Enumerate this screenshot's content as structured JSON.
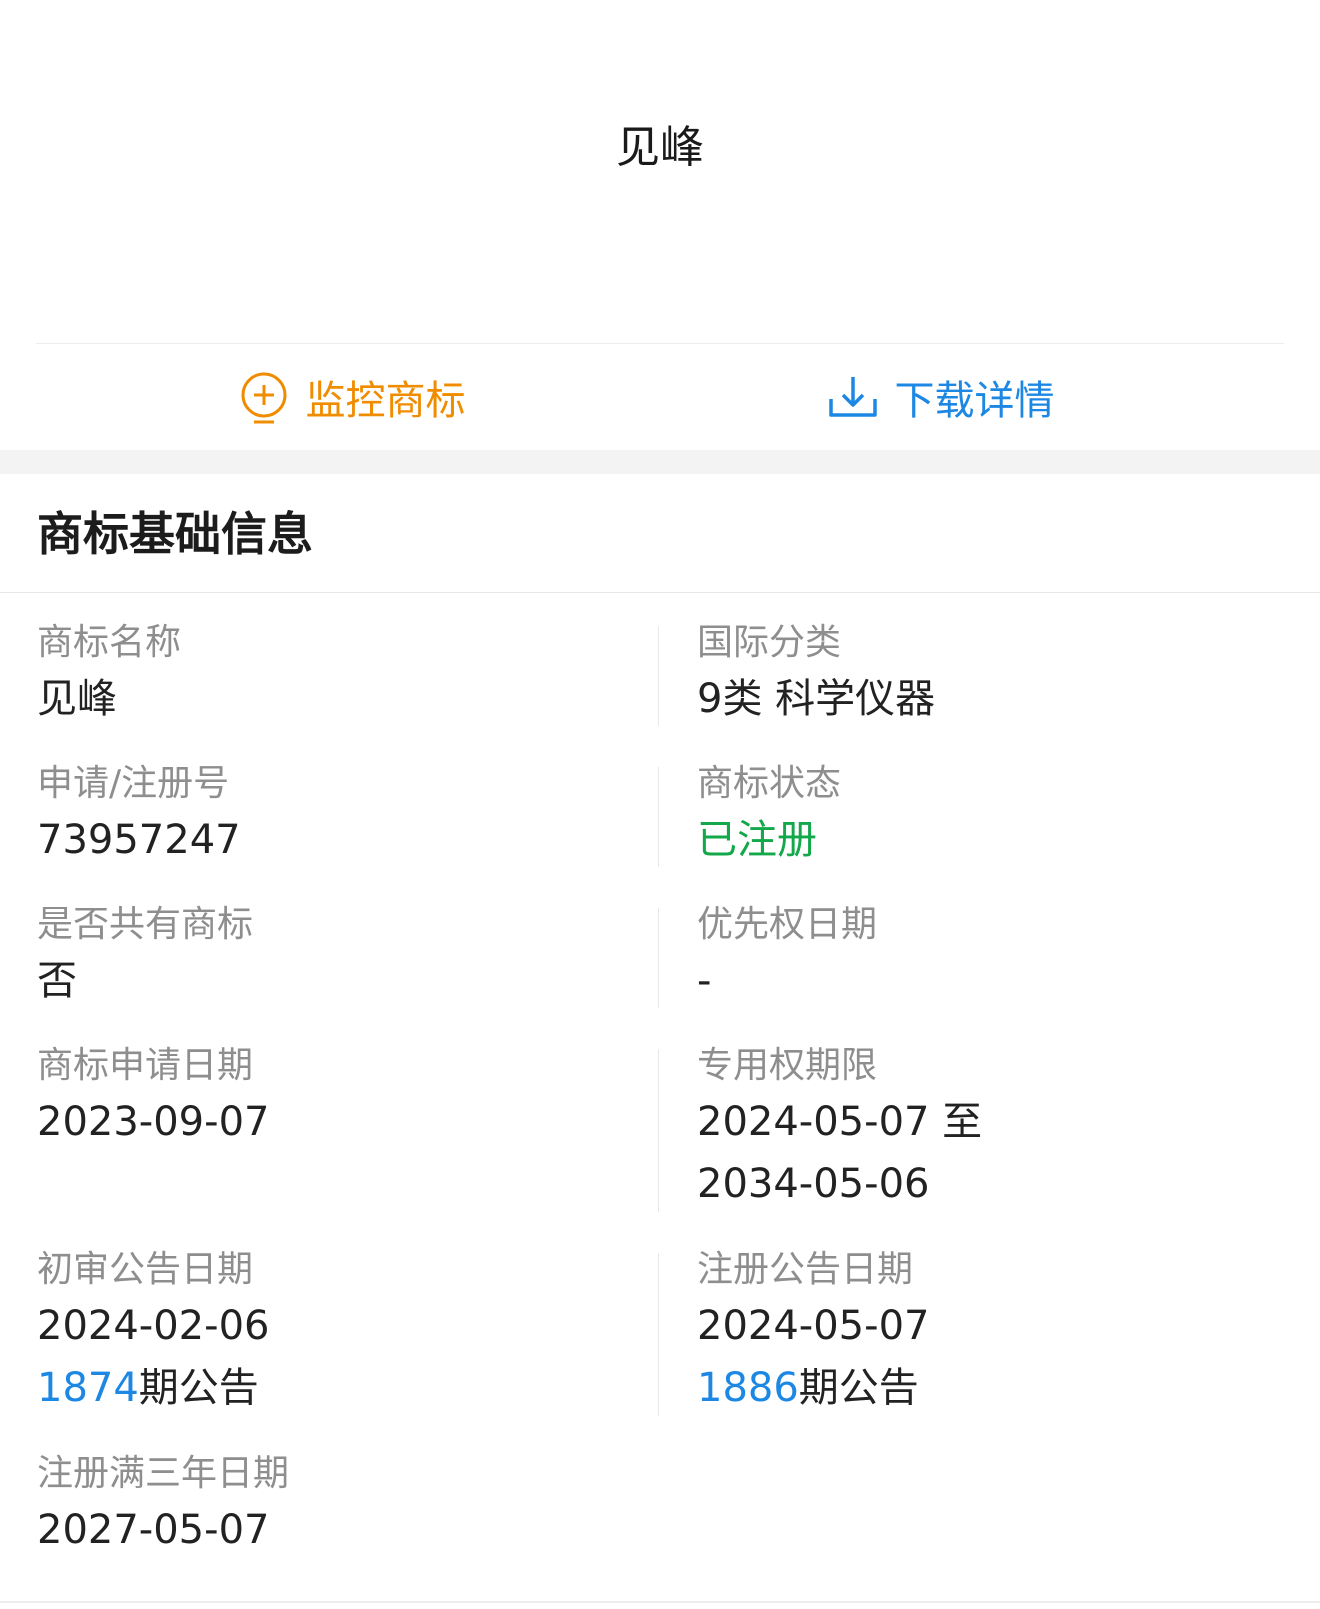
{
  "logo": {
    "text": "见峰"
  },
  "actions": {
    "monitor_label": "监控商标",
    "download_label": "下载详情",
    "monitor_color": "#f08c00",
    "download_color": "#1d87e4"
  },
  "section": {
    "title": "商标基础信息"
  },
  "fields": {
    "name": {
      "label": "商标名称",
      "value": "见峰"
    },
    "intl_class": {
      "label": "国际分类",
      "value": "9类 科学仪器"
    },
    "reg_no": {
      "label": "申请/注册号",
      "value": "73957247"
    },
    "status": {
      "label": "商标状态",
      "value": "已注册",
      "color": "#13a84a"
    },
    "shared": {
      "label": "是否共有商标",
      "value": "否"
    },
    "priority_date": {
      "label": "优先权日期",
      "value": "-"
    },
    "apply_date": {
      "label": "商标申请日期",
      "value": "2023-09-07"
    },
    "exclusive_period": {
      "label": "专用权期限",
      "value_line1": "2024-05-07 至",
      "value_line2": "2034-05-06"
    },
    "prelim_pub": {
      "label": "初审公告日期",
      "value": "2024-02-06",
      "issue": "1874",
      "issue_suffix": "期公告"
    },
    "reg_pub": {
      "label": "注册公告日期",
      "value": "2024-05-07",
      "issue": "1886",
      "issue_suffix": "期公告"
    },
    "three_year": {
      "label": "注册满三年日期",
      "value": "2027-05-07"
    }
  }
}
